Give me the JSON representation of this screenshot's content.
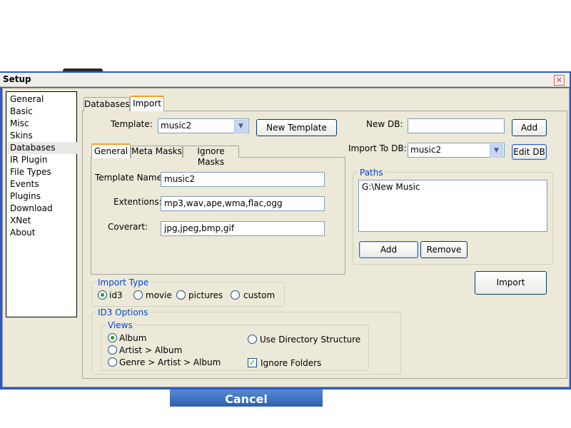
{
  "window": {
    "title": "Setup",
    "close_glyph": "✕"
  },
  "background": {
    "strip_label": "Cancel"
  },
  "nav": {
    "items": [
      {
        "label": "General"
      },
      {
        "label": "Basic"
      },
      {
        "label": "Misc"
      },
      {
        "label": "Skins"
      },
      {
        "label": "Databases",
        "selected": true
      },
      {
        "label": "IR Plugin"
      },
      {
        "label": "File Types"
      },
      {
        "label": "Events"
      },
      {
        "label": "Plugins"
      },
      {
        "label": "Download"
      },
      {
        "label": "XNet"
      },
      {
        "label": "About"
      }
    ]
  },
  "tabs": {
    "databases": "Databases",
    "import": "Import"
  },
  "template": {
    "label": "Template:",
    "value": "music2",
    "new_button": "New Template"
  },
  "new_db": {
    "label": "New DB:",
    "value": "",
    "add_button": "Add"
  },
  "import_to": {
    "label": "Import To DB:",
    "value": "music2",
    "edit_button": "Edit DB"
  },
  "subtabs": {
    "general": "General",
    "meta": "Meta Masks",
    "ignore": "Ignore Masks"
  },
  "fields": {
    "template_name": {
      "label": "Template Name:",
      "value": "music2"
    },
    "extensions": {
      "label": "Extentions:",
      "value": "mp3,wav,ape,wma,flac,ogg"
    },
    "coverart": {
      "label": "Coverart:",
      "value": "jpg,jpeg,bmp,gif"
    }
  },
  "paths": {
    "legend": "Paths",
    "items": [
      "G:\\New Music"
    ],
    "add_button": "Add",
    "remove_button": "Remove"
  },
  "import_button": "Import",
  "import_type": {
    "legend": "Import Type",
    "options": [
      {
        "label": "id3",
        "selected": true
      },
      {
        "label": "movie"
      },
      {
        "label": "pictures"
      },
      {
        "label": "custom"
      }
    ]
  },
  "id3": {
    "legend": "ID3 Options",
    "views_legend": "Views",
    "views": [
      {
        "label": "Album",
        "selected": true
      },
      {
        "label": "Artist > Album"
      },
      {
        "label": "Genre > Artist > Album"
      }
    ],
    "use_dir": {
      "label": "Use Directory Structure"
    },
    "ignore_folders": {
      "label": "Ignore Folders",
      "checked": true
    }
  },
  "icons": {
    "dropdown": "chevron-down-icon",
    "check": "✓"
  }
}
